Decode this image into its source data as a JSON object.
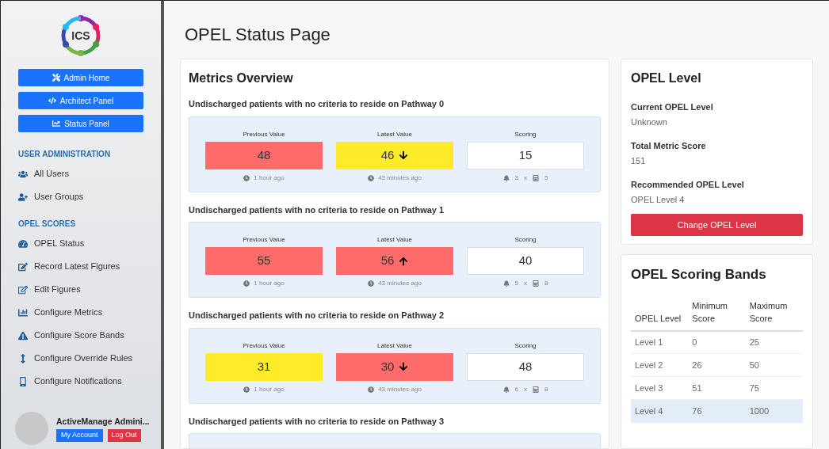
{
  "sidebar": {
    "logo_text": "ICS",
    "buttons": [
      "Admin Home",
      "Architect Panel",
      "Status Panel"
    ],
    "sections": [
      {
        "title": "USER ADMINISTRATION",
        "items": [
          "All Users",
          "User Groups"
        ]
      },
      {
        "title": "OPEL SCORES",
        "items": [
          "OPEL Status",
          "Record Latest Figures",
          "Edit Figures",
          "Configure Metrics",
          "Configure Score Bands",
          "Configure Override Rules",
          "Configure Notifications"
        ]
      }
    ],
    "user": {
      "name": "ActiveManage Admini...",
      "account_button": "My Account",
      "logout_button": "Log Out"
    }
  },
  "page_title": "OPEL Status Page",
  "metrics": {
    "title": "Metrics Overview",
    "items": [
      {
        "label": "Undischarged patients with no criteria to reside on Pathway 0",
        "previous": {
          "heading": "Previous Value",
          "value": "48",
          "color": "#ff6b6b",
          "time": "1 hour ago"
        },
        "latest": {
          "heading": "Latest Value",
          "value": "46",
          "color": "#ffeb2a",
          "rising": false,
          "time": "43 minutes ago"
        },
        "scoring": {
          "heading": "Scoring",
          "value": "15",
          "weight": "3",
          "times": "x",
          "score": "5"
        }
      },
      {
        "label": "Undischarged patients with no criteria to reside on Pathway 1",
        "previous": {
          "heading": "Previous Value",
          "value": "55",
          "color": "#ff6b6b",
          "time": "1 hour ago"
        },
        "latest": {
          "heading": "Latest Value",
          "value": "56",
          "color": "#ff6b6b",
          "rising": true,
          "time": "43 minutes ago"
        },
        "scoring": {
          "heading": "Scoring",
          "value": "40",
          "weight": "5",
          "times": "x",
          "score": "8"
        }
      },
      {
        "label": "Undischarged patients with no criteria to reside on Pathway 2",
        "previous": {
          "heading": "Previous Value",
          "value": "31",
          "color": "#ffeb2a",
          "time": "1 hour ago"
        },
        "latest": {
          "heading": "Latest Value",
          "value": "30",
          "color": "#ff6b6b",
          "rising": false,
          "time": "43 minutes ago"
        },
        "scoring": {
          "heading": "Scoring",
          "value": "48",
          "weight": "6",
          "times": "x",
          "score": "8"
        }
      },
      {
        "label": "Undischarged patients with no criteria to reside on Pathway 3"
      }
    ]
  },
  "opel_level": {
    "title": "OPEL Level",
    "fields": [
      {
        "label": "Current OPEL Level",
        "value": "Unknown"
      },
      {
        "label": "Total Metric Score",
        "value": "151"
      },
      {
        "label": "Recommended OPEL Level",
        "value": "OPEL Level 4"
      }
    ],
    "button": "Change OPEL Level"
  },
  "bands": {
    "title": "OPEL Scoring Bands",
    "columns": [
      "OPEL Level",
      "Minimum Score",
      "Maximum Score"
    ],
    "rows": [
      {
        "cells": [
          "Level 1",
          "0",
          "25"
        ],
        "selected": false
      },
      {
        "cells": [
          "Level 2",
          "26",
          "50"
        ],
        "selected": false
      },
      {
        "cells": [
          "Level 3",
          "51",
          "75"
        ],
        "selected": false
      },
      {
        "cells": [
          "Level 4",
          "76",
          "1000"
        ],
        "selected": true
      }
    ]
  }
}
